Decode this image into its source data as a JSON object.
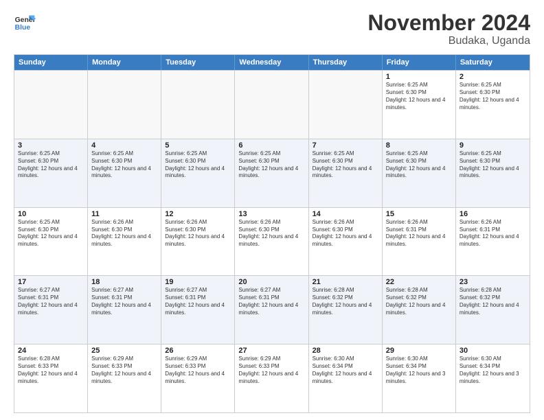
{
  "logo": {
    "general": "General",
    "blue": "Blue"
  },
  "title": "November 2024",
  "location": "Budaka, Uganda",
  "days": [
    "Sunday",
    "Monday",
    "Tuesday",
    "Wednesday",
    "Thursday",
    "Friday",
    "Saturday"
  ],
  "rows": [
    {
      "alt": false,
      "cells": [
        {
          "empty": true,
          "day": "",
          "text": ""
        },
        {
          "empty": true,
          "day": "",
          "text": ""
        },
        {
          "empty": true,
          "day": "",
          "text": ""
        },
        {
          "empty": true,
          "day": "",
          "text": ""
        },
        {
          "empty": true,
          "day": "",
          "text": ""
        },
        {
          "empty": false,
          "day": "1",
          "text": "Sunrise: 6:25 AM\nSunset: 6:30 PM\nDaylight: 12 hours and 4 minutes."
        },
        {
          "empty": false,
          "day": "2",
          "text": "Sunrise: 6:25 AM\nSunset: 6:30 PM\nDaylight: 12 hours and 4 minutes."
        }
      ]
    },
    {
      "alt": true,
      "cells": [
        {
          "empty": false,
          "day": "3",
          "text": "Sunrise: 6:25 AM\nSunset: 6:30 PM\nDaylight: 12 hours and 4 minutes."
        },
        {
          "empty": false,
          "day": "4",
          "text": "Sunrise: 6:25 AM\nSunset: 6:30 PM\nDaylight: 12 hours and 4 minutes."
        },
        {
          "empty": false,
          "day": "5",
          "text": "Sunrise: 6:25 AM\nSunset: 6:30 PM\nDaylight: 12 hours and 4 minutes."
        },
        {
          "empty": false,
          "day": "6",
          "text": "Sunrise: 6:25 AM\nSunset: 6:30 PM\nDaylight: 12 hours and 4 minutes."
        },
        {
          "empty": false,
          "day": "7",
          "text": "Sunrise: 6:25 AM\nSunset: 6:30 PM\nDaylight: 12 hours and 4 minutes."
        },
        {
          "empty": false,
          "day": "8",
          "text": "Sunrise: 6:25 AM\nSunset: 6:30 PM\nDaylight: 12 hours and 4 minutes."
        },
        {
          "empty": false,
          "day": "9",
          "text": "Sunrise: 6:25 AM\nSunset: 6:30 PM\nDaylight: 12 hours and 4 minutes."
        }
      ]
    },
    {
      "alt": false,
      "cells": [
        {
          "empty": false,
          "day": "10",
          "text": "Sunrise: 6:25 AM\nSunset: 6:30 PM\nDaylight: 12 hours and 4 minutes."
        },
        {
          "empty": false,
          "day": "11",
          "text": "Sunrise: 6:26 AM\nSunset: 6:30 PM\nDaylight: 12 hours and 4 minutes."
        },
        {
          "empty": false,
          "day": "12",
          "text": "Sunrise: 6:26 AM\nSunset: 6:30 PM\nDaylight: 12 hours and 4 minutes."
        },
        {
          "empty": false,
          "day": "13",
          "text": "Sunrise: 6:26 AM\nSunset: 6:30 PM\nDaylight: 12 hours and 4 minutes."
        },
        {
          "empty": false,
          "day": "14",
          "text": "Sunrise: 6:26 AM\nSunset: 6:30 PM\nDaylight: 12 hours and 4 minutes."
        },
        {
          "empty": false,
          "day": "15",
          "text": "Sunrise: 6:26 AM\nSunset: 6:31 PM\nDaylight: 12 hours and 4 minutes."
        },
        {
          "empty": false,
          "day": "16",
          "text": "Sunrise: 6:26 AM\nSunset: 6:31 PM\nDaylight: 12 hours and 4 minutes."
        }
      ]
    },
    {
      "alt": true,
      "cells": [
        {
          "empty": false,
          "day": "17",
          "text": "Sunrise: 6:27 AM\nSunset: 6:31 PM\nDaylight: 12 hours and 4 minutes."
        },
        {
          "empty": false,
          "day": "18",
          "text": "Sunrise: 6:27 AM\nSunset: 6:31 PM\nDaylight: 12 hours and 4 minutes."
        },
        {
          "empty": false,
          "day": "19",
          "text": "Sunrise: 6:27 AM\nSunset: 6:31 PM\nDaylight: 12 hours and 4 minutes."
        },
        {
          "empty": false,
          "day": "20",
          "text": "Sunrise: 6:27 AM\nSunset: 6:31 PM\nDaylight: 12 hours and 4 minutes."
        },
        {
          "empty": false,
          "day": "21",
          "text": "Sunrise: 6:28 AM\nSunset: 6:32 PM\nDaylight: 12 hours and 4 minutes."
        },
        {
          "empty": false,
          "day": "22",
          "text": "Sunrise: 6:28 AM\nSunset: 6:32 PM\nDaylight: 12 hours and 4 minutes."
        },
        {
          "empty": false,
          "day": "23",
          "text": "Sunrise: 6:28 AM\nSunset: 6:32 PM\nDaylight: 12 hours and 4 minutes."
        }
      ]
    },
    {
      "alt": false,
      "cells": [
        {
          "empty": false,
          "day": "24",
          "text": "Sunrise: 6:28 AM\nSunset: 6:33 PM\nDaylight: 12 hours and 4 minutes."
        },
        {
          "empty": false,
          "day": "25",
          "text": "Sunrise: 6:29 AM\nSunset: 6:33 PM\nDaylight: 12 hours and 4 minutes."
        },
        {
          "empty": false,
          "day": "26",
          "text": "Sunrise: 6:29 AM\nSunset: 6:33 PM\nDaylight: 12 hours and 4 minutes."
        },
        {
          "empty": false,
          "day": "27",
          "text": "Sunrise: 6:29 AM\nSunset: 6:33 PM\nDaylight: 12 hours and 4 minutes."
        },
        {
          "empty": false,
          "day": "28",
          "text": "Sunrise: 6:30 AM\nSunset: 6:34 PM\nDaylight: 12 hours and 4 minutes."
        },
        {
          "empty": false,
          "day": "29",
          "text": "Sunrise: 6:30 AM\nSunset: 6:34 PM\nDaylight: 12 hours and 3 minutes."
        },
        {
          "empty": false,
          "day": "30",
          "text": "Sunrise: 6:30 AM\nSunset: 6:34 PM\nDaylight: 12 hours and 3 minutes."
        }
      ]
    }
  ]
}
